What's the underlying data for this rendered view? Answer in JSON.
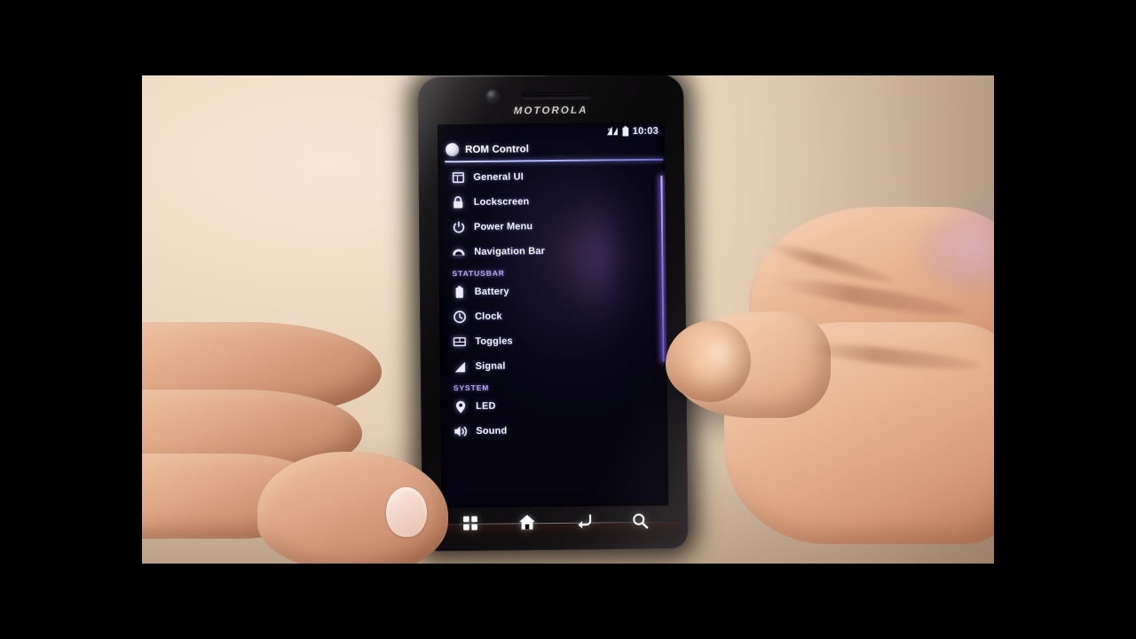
{
  "scene": {
    "description": "hand-held Motorola smartphone displaying the ROM Control app",
    "device_brand": "MOTOROLA"
  },
  "statusbar": {
    "signal_icon": "signal-bars-icon",
    "battery_icon": "battery-icon",
    "clock": "10:03"
  },
  "app": {
    "icon": "rom-control-app-icon",
    "title": "ROM Control"
  },
  "menu": [
    {
      "kind": "item",
      "icon": "general-ui-icon",
      "label": "General UI"
    },
    {
      "kind": "item",
      "icon": "lock-icon",
      "label": "Lockscreen"
    },
    {
      "kind": "item",
      "icon": "power-icon",
      "label": "Power Menu"
    },
    {
      "kind": "item",
      "icon": "navigation-bar-icon",
      "label": "Navigation Bar"
    },
    {
      "kind": "section",
      "label": "STATUSBAR"
    },
    {
      "kind": "item",
      "icon": "battery-icon",
      "label": "Battery"
    },
    {
      "kind": "item",
      "icon": "clock-icon",
      "label": "Clock"
    },
    {
      "kind": "item",
      "icon": "toggles-icon",
      "label": "Toggles"
    },
    {
      "kind": "item",
      "icon": "signal-icon",
      "label": "Signal"
    },
    {
      "kind": "section",
      "label": "SYSTEM"
    },
    {
      "kind": "item",
      "icon": "led-icon",
      "label": "LED"
    },
    {
      "kind": "item",
      "icon": "sound-icon",
      "label": "Sound"
    }
  ],
  "navbar": [
    {
      "icon": "menu-grid-icon",
      "label": "Menu"
    },
    {
      "icon": "home-icon",
      "label": "Home"
    },
    {
      "icon": "back-icon",
      "label": "Back"
    },
    {
      "icon": "search-icon",
      "label": "Search"
    }
  ],
  "colors": {
    "screen_background": "#0a0818",
    "accent_purple": "#b5a8ea",
    "divider": "#aab0ff",
    "text_primary": "#f3f2ff",
    "scrollbar": "#8f7bf0",
    "wall": "#efdcc4",
    "letterbox": "#000000"
  }
}
